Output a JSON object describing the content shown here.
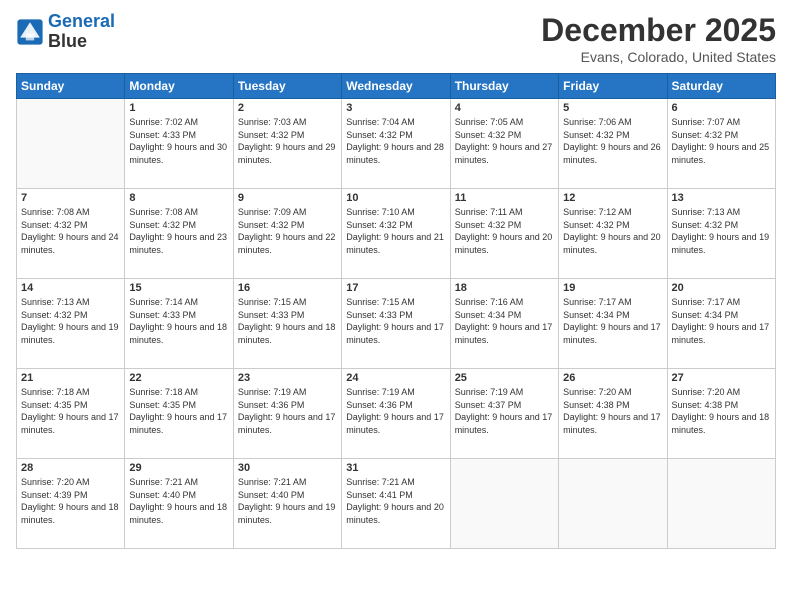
{
  "header": {
    "logo_line1": "General",
    "logo_line2": "Blue",
    "month": "December 2025",
    "location": "Evans, Colorado, United States"
  },
  "days_of_week": [
    "Sunday",
    "Monday",
    "Tuesday",
    "Wednesday",
    "Thursday",
    "Friday",
    "Saturday"
  ],
  "weeks": [
    [
      {
        "num": "",
        "sunrise": "",
        "sunset": "",
        "daylight": ""
      },
      {
        "num": "1",
        "sunrise": "Sunrise: 7:02 AM",
        "sunset": "Sunset: 4:33 PM",
        "daylight": "Daylight: 9 hours and 30 minutes."
      },
      {
        "num": "2",
        "sunrise": "Sunrise: 7:03 AM",
        "sunset": "Sunset: 4:32 PM",
        "daylight": "Daylight: 9 hours and 29 minutes."
      },
      {
        "num": "3",
        "sunrise": "Sunrise: 7:04 AM",
        "sunset": "Sunset: 4:32 PM",
        "daylight": "Daylight: 9 hours and 28 minutes."
      },
      {
        "num": "4",
        "sunrise": "Sunrise: 7:05 AM",
        "sunset": "Sunset: 4:32 PM",
        "daylight": "Daylight: 9 hours and 27 minutes."
      },
      {
        "num": "5",
        "sunrise": "Sunrise: 7:06 AM",
        "sunset": "Sunset: 4:32 PM",
        "daylight": "Daylight: 9 hours and 26 minutes."
      },
      {
        "num": "6",
        "sunrise": "Sunrise: 7:07 AM",
        "sunset": "Sunset: 4:32 PM",
        "daylight": "Daylight: 9 hours and 25 minutes."
      }
    ],
    [
      {
        "num": "7",
        "sunrise": "Sunrise: 7:08 AM",
        "sunset": "Sunset: 4:32 PM",
        "daylight": "Daylight: 9 hours and 24 minutes."
      },
      {
        "num": "8",
        "sunrise": "Sunrise: 7:08 AM",
        "sunset": "Sunset: 4:32 PM",
        "daylight": "Daylight: 9 hours and 23 minutes."
      },
      {
        "num": "9",
        "sunrise": "Sunrise: 7:09 AM",
        "sunset": "Sunset: 4:32 PM",
        "daylight": "Daylight: 9 hours and 22 minutes."
      },
      {
        "num": "10",
        "sunrise": "Sunrise: 7:10 AM",
        "sunset": "Sunset: 4:32 PM",
        "daylight": "Daylight: 9 hours and 21 minutes."
      },
      {
        "num": "11",
        "sunrise": "Sunrise: 7:11 AM",
        "sunset": "Sunset: 4:32 PM",
        "daylight": "Daylight: 9 hours and 20 minutes."
      },
      {
        "num": "12",
        "sunrise": "Sunrise: 7:12 AM",
        "sunset": "Sunset: 4:32 PM",
        "daylight": "Daylight: 9 hours and 20 minutes."
      },
      {
        "num": "13",
        "sunrise": "Sunrise: 7:13 AM",
        "sunset": "Sunset: 4:32 PM",
        "daylight": "Daylight: 9 hours and 19 minutes."
      }
    ],
    [
      {
        "num": "14",
        "sunrise": "Sunrise: 7:13 AM",
        "sunset": "Sunset: 4:32 PM",
        "daylight": "Daylight: 9 hours and 19 minutes."
      },
      {
        "num": "15",
        "sunrise": "Sunrise: 7:14 AM",
        "sunset": "Sunset: 4:33 PM",
        "daylight": "Daylight: 9 hours and 18 minutes."
      },
      {
        "num": "16",
        "sunrise": "Sunrise: 7:15 AM",
        "sunset": "Sunset: 4:33 PM",
        "daylight": "Daylight: 9 hours and 18 minutes."
      },
      {
        "num": "17",
        "sunrise": "Sunrise: 7:15 AM",
        "sunset": "Sunset: 4:33 PM",
        "daylight": "Daylight: 9 hours and 17 minutes."
      },
      {
        "num": "18",
        "sunrise": "Sunrise: 7:16 AM",
        "sunset": "Sunset: 4:34 PM",
        "daylight": "Daylight: 9 hours and 17 minutes."
      },
      {
        "num": "19",
        "sunrise": "Sunrise: 7:17 AM",
        "sunset": "Sunset: 4:34 PM",
        "daylight": "Daylight: 9 hours and 17 minutes."
      },
      {
        "num": "20",
        "sunrise": "Sunrise: 7:17 AM",
        "sunset": "Sunset: 4:34 PM",
        "daylight": "Daylight: 9 hours and 17 minutes."
      }
    ],
    [
      {
        "num": "21",
        "sunrise": "Sunrise: 7:18 AM",
        "sunset": "Sunset: 4:35 PM",
        "daylight": "Daylight: 9 hours and 17 minutes."
      },
      {
        "num": "22",
        "sunrise": "Sunrise: 7:18 AM",
        "sunset": "Sunset: 4:35 PM",
        "daylight": "Daylight: 9 hours and 17 minutes."
      },
      {
        "num": "23",
        "sunrise": "Sunrise: 7:19 AM",
        "sunset": "Sunset: 4:36 PM",
        "daylight": "Daylight: 9 hours and 17 minutes."
      },
      {
        "num": "24",
        "sunrise": "Sunrise: 7:19 AM",
        "sunset": "Sunset: 4:36 PM",
        "daylight": "Daylight: 9 hours and 17 minutes."
      },
      {
        "num": "25",
        "sunrise": "Sunrise: 7:19 AM",
        "sunset": "Sunset: 4:37 PM",
        "daylight": "Daylight: 9 hours and 17 minutes."
      },
      {
        "num": "26",
        "sunrise": "Sunrise: 7:20 AM",
        "sunset": "Sunset: 4:38 PM",
        "daylight": "Daylight: 9 hours and 17 minutes."
      },
      {
        "num": "27",
        "sunrise": "Sunrise: 7:20 AM",
        "sunset": "Sunset: 4:38 PM",
        "daylight": "Daylight: 9 hours and 18 minutes."
      }
    ],
    [
      {
        "num": "28",
        "sunrise": "Sunrise: 7:20 AM",
        "sunset": "Sunset: 4:39 PM",
        "daylight": "Daylight: 9 hours and 18 minutes."
      },
      {
        "num": "29",
        "sunrise": "Sunrise: 7:21 AM",
        "sunset": "Sunset: 4:40 PM",
        "daylight": "Daylight: 9 hours and 18 minutes."
      },
      {
        "num": "30",
        "sunrise": "Sunrise: 7:21 AM",
        "sunset": "Sunset: 4:40 PM",
        "daylight": "Daylight: 9 hours and 19 minutes."
      },
      {
        "num": "31",
        "sunrise": "Sunrise: 7:21 AM",
        "sunset": "Sunset: 4:41 PM",
        "daylight": "Daylight: 9 hours and 20 minutes."
      },
      {
        "num": "",
        "sunrise": "",
        "sunset": "",
        "daylight": ""
      },
      {
        "num": "",
        "sunrise": "",
        "sunset": "",
        "daylight": ""
      },
      {
        "num": "",
        "sunrise": "",
        "sunset": "",
        "daylight": ""
      }
    ]
  ]
}
